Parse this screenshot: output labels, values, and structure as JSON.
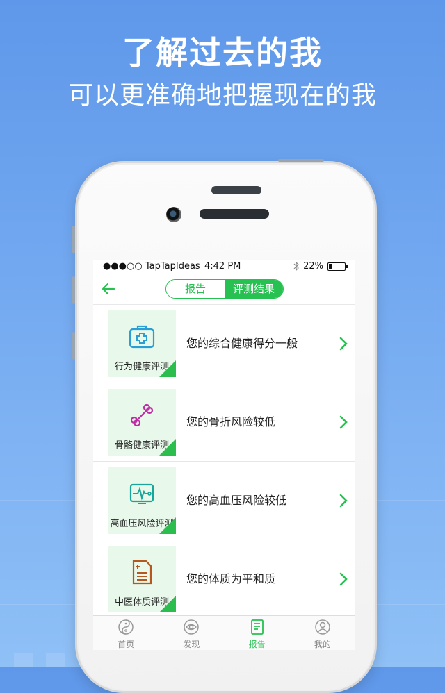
{
  "promo": {
    "headline": "了解过去的我",
    "subheadline": "可以更准确地把握现在的我"
  },
  "status_bar": {
    "carrier": "●●●○○ TapTapIdeas",
    "time": "4:42 PM",
    "battery": "22%"
  },
  "nav": {
    "segments": [
      {
        "label": "报告",
        "active": false
      },
      {
        "label": "评测结果",
        "active": true
      }
    ]
  },
  "results": [
    {
      "tile_label": "行为健康评测",
      "message": "您的综合健康得分一般",
      "icon": "medical-kit-icon"
    },
    {
      "tile_label": "骨骼健康评测",
      "message": "您的骨折风险较低",
      "icon": "bone-icon"
    },
    {
      "tile_label": "高血压风险评测",
      "message": "您的高血压风险较低",
      "icon": "heart-monitor-icon"
    },
    {
      "tile_label": "中医体质评测",
      "message": "您的体质为平和质",
      "icon": "document-plus-icon"
    }
  ],
  "tabbar": [
    {
      "label": "首页",
      "icon": "yin-yang-icon",
      "active": false
    },
    {
      "label": "发现",
      "icon": "eye-icon",
      "active": false
    },
    {
      "label": "报告",
      "icon": "report-icon",
      "active": true
    },
    {
      "label": "我的",
      "icon": "user-icon",
      "active": false
    }
  ],
  "colors": {
    "accent": "#27c152",
    "tile_bg": "#e8f8ea",
    "icon_blue": "#2a9fd6",
    "icon_magenta": "#c02aa6",
    "icon_teal": "#1aa59a",
    "icon_brown": "#b5571e"
  }
}
